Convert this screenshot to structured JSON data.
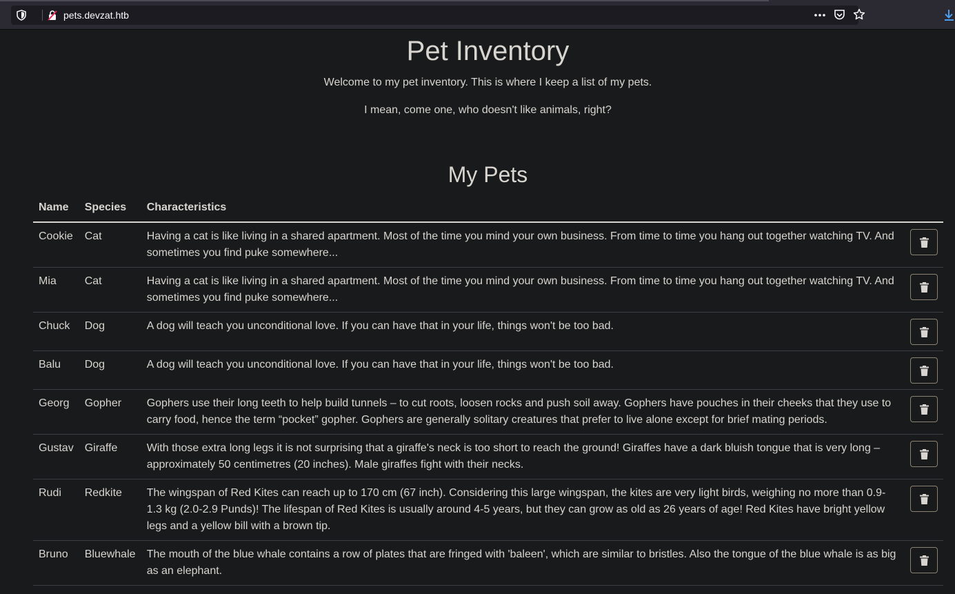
{
  "browser": {
    "url": "pets.devzat.htb"
  },
  "page": {
    "title": "Pet Inventory",
    "intro_line1": "Welcome to my pet inventory. This is where I keep a list of my pets.",
    "intro_line2": "I mean, come one, who doesn't like animals, right?",
    "section_title": "My Pets"
  },
  "table": {
    "headers": [
      "Name",
      "Species",
      "Characteristics"
    ],
    "rows": [
      {
        "name": "Cookie",
        "species": "Cat",
        "characteristics": "Having a cat is like living in a shared apartment. Most of the time you mind your own business. From time to time you hang out together watching TV. And sometimes you find puke somewhere..."
      },
      {
        "name": "Mia",
        "species": "Cat",
        "characteristics": "Having a cat is like living in a shared apartment. Most of the time you mind your own business. From time to time you hang out together watching TV. And sometimes you find puke somewhere..."
      },
      {
        "name": "Chuck",
        "species": "Dog",
        "characteristics": "A dog will teach you unconditional love. If you can have that in your life, things won't be too bad."
      },
      {
        "name": "Balu",
        "species": "Dog",
        "characteristics": "A dog will teach you unconditional love. If you can have that in your life, things won't be too bad."
      },
      {
        "name": "Georg",
        "species": "Gopher",
        "characteristics": "Gophers use their long teeth to help build tunnels – to cut roots, loosen rocks and push soil away. Gophers have pouches in their cheeks that they use to carry food, hence the term “pocket” gopher. Gophers are generally solitary creatures that prefer to live alone except for brief mating periods."
      },
      {
        "name": "Gustav",
        "species": "Giraffe",
        "characteristics": "With those extra long legs it is not surprising that a giraffe's neck is too short to reach the ground! Giraffes have a dark bluish tongue that is very long – approximately 50 centimetres (20 inches). Male giraffes fight with their necks."
      },
      {
        "name": "Rudi",
        "species": "Redkite",
        "characteristics": "The wingspan of Red Kites can reach up to 170 cm (67 inch). Considering this large wingspan, the kites are very light birds, weighing no more than 0.9-1.3 kg (2.0-2.9 Punds)! The lifespan of Red Kites is usually around 4-5 years, but they can grow as old as 26 years of age! Red Kites have bright yellow legs and a yellow bill with a brown tip."
      },
      {
        "name": "Bruno",
        "species": "Bluewhale",
        "characteristics": "The mouth of the blue whale contains a row of plates that are fringed with 'baleen', which are similar to bristles. Also the tongue of the blue whale is as big as an elephant."
      }
    ]
  },
  "icons": {
    "delete": "trash-icon",
    "shield": "tracking-shield-icon",
    "lock": "insecure-lock-icon",
    "menu": "page-actions-dots-icon",
    "pocket": "pocket-icon",
    "bookmark": "bookmark-star-icon",
    "download": "download-arrow-icon"
  },
  "colors": {
    "page_bg": "#181a1b",
    "text": "#d8d4cf",
    "button_border": "#8c8273",
    "download_accent": "#4a9ff5"
  }
}
